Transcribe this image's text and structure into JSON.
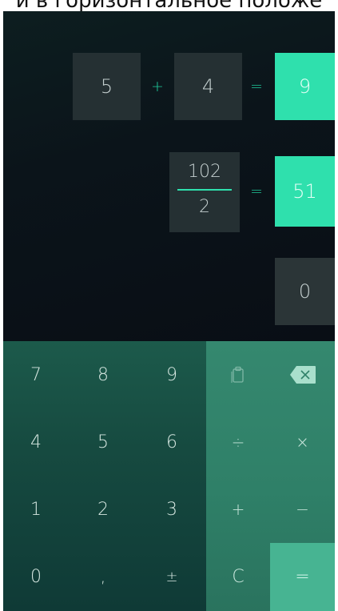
{
  "caption": "и в горизонтальное положе",
  "display": {
    "row1": {
      "a": "5",
      "op": "+",
      "b": "4",
      "eq": "=",
      "result": "9"
    },
    "row2": {
      "numerator": "102",
      "denominator": "2",
      "eq": "=",
      "result": "51"
    },
    "row3": {
      "value": "0"
    }
  },
  "keypad": {
    "digits": [
      "7",
      "8",
      "9",
      "4",
      "5",
      "6",
      "1",
      "2",
      "3",
      "0",
      ",",
      "±"
    ],
    "ops": {
      "paste_icon": "clipboard-icon",
      "backspace_icon": "backspace-icon",
      "divide": "÷",
      "multiply": "×",
      "add": "+",
      "subtract": "−",
      "clear": "C",
      "equals": "="
    }
  },
  "colors": {
    "accent": "#2fe0ad",
    "display_bg": "#0b141a",
    "digit_pad": "#164a40",
    "op_pad": "#2f8068"
  }
}
